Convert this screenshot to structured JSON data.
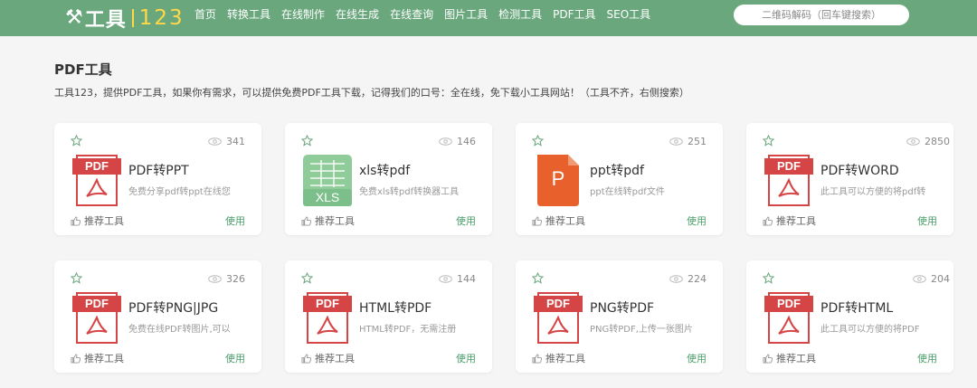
{
  "header": {
    "logo_mark": "⚒",
    "logo_text": "工具",
    "logo_num": "123",
    "nav": [
      "首页",
      "转换工具",
      "在线制作",
      "在线生成",
      "在线查询",
      "图片工具",
      "检测工具",
      "PDF工具",
      "SEO工具"
    ],
    "search_placeholder": "二维码解码（回车键搜索）"
  },
  "page": {
    "title": "PDF工具",
    "description": "工具123，提供PDF工具，如果你有需求，可以提供免费PDF工具下载，记得我们的口号：全在线，免下载小工具网站！（工具不齐，右侧搜索）"
  },
  "colors": {
    "accent": "#6aa77d",
    "logo_yellow": "#ffd84a",
    "pdf_red": "#d64545",
    "xls_green": "#8fcc9a",
    "ppt_orange": "#e8612c",
    "use_green": "#4a9d69"
  },
  "cards": [
    {
      "title": "PDF转PPT",
      "desc": "免费分享pdf转ppt在线您",
      "views": "341",
      "icon": "pdf-icon",
      "icon_label": "PDF",
      "recommend": "推荐工具",
      "use": "使用"
    },
    {
      "title": "xls转pdf",
      "desc": "免费xls转pdf转换器工具",
      "views": "146",
      "icon": "xls-icon",
      "icon_label": "XLS",
      "recommend": "推荐工具",
      "use": "使用"
    },
    {
      "title": "ppt转pdf",
      "desc": "ppt在线转pdf文件",
      "views": "251",
      "icon": "ppt-icon",
      "icon_label": "P",
      "recommend": "推荐工具",
      "use": "使用"
    },
    {
      "title": "PDF转WORD",
      "desc": "此工具可以方便的将pdf转",
      "views": "2850",
      "icon": "pdf-icon",
      "icon_label": "PDF",
      "recommend": "推荐工具",
      "use": "使用"
    },
    {
      "title": "PDF转PNG|JPG",
      "desc": "免费在线PDF转图片,可以",
      "views": "326",
      "icon": "pdf-icon",
      "icon_label": "PDF",
      "recommend": "推荐工具",
      "use": "使用"
    },
    {
      "title": "HTML转PDF",
      "desc": "HTML转PDF，无需注册",
      "views": "144",
      "icon": "pdf-icon",
      "icon_label": "PDF",
      "recommend": "推荐工具",
      "use": "使用"
    },
    {
      "title": "PNG转PDF",
      "desc": "PNG转PDF,上传一张图片",
      "views": "224",
      "icon": "pdf-icon",
      "icon_label": "PDF",
      "recommend": "推荐工具",
      "use": "使用"
    },
    {
      "title": "PDF转HTML",
      "desc": "此工具可以方便的将PDF",
      "views": "204",
      "icon": "pdf-icon",
      "icon_label": "PDF",
      "recommend": "推荐工具",
      "use": "使用"
    }
  ]
}
